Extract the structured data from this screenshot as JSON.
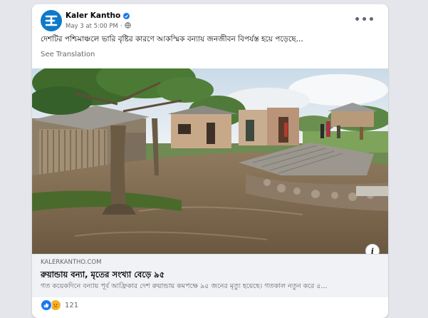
{
  "post": {
    "page_name": "Kaler Kantho",
    "date": "May 3 at 5:00 PM",
    "separator": "·",
    "text": "দেশটির পশ্চিমাঞ্চলে ভারি বৃষ্টির কারণে আকস্মিক বন্যায় জনজীবন বিপর্যস্ত হয়ে পড়েছে...",
    "see_translation": "See Translation",
    "more_label": "•••"
  },
  "link_preview": {
    "domain": "KALERKANTHO.COM",
    "title": "রুয়ান্ডায় বন্যা, মৃতের সংখ্যা বেড়ে ৯৫",
    "description": "গত কয়েকদিনে বন্যায় পূর্ব আফ্রিকার দেশ রুয়ান্ডায় কমপক্ষে ৯৫ জনের মৃত্যু হয়েছে। গতকাল নতুন করে ৫..."
  },
  "reactions": {
    "count": "121"
  },
  "colors": {
    "accent": "#1877f2",
    "avatar": "#0f79c9",
    "page_bg": "#e4e6eb"
  },
  "icons": [
    "page-avatar-icon",
    "verified-badge-icon",
    "globe-icon",
    "more-options-icon",
    "info-icon",
    "like-reaction-icon",
    "sad-reaction-icon"
  ]
}
